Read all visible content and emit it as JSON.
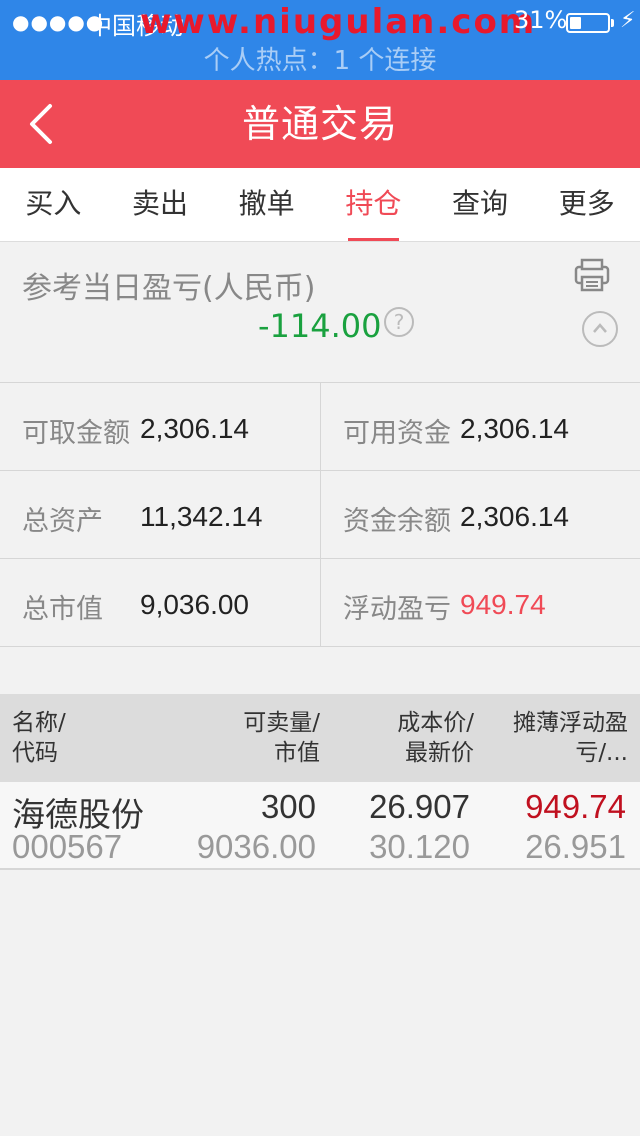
{
  "status_bar": {
    "signal": "●●●●●",
    "carrier": "中国移动",
    "watermark": "www.niugulan.com",
    "battery_percent": "31%",
    "battery_level": 0.31,
    "hotspot": "个人热点：1 个连接"
  },
  "nav": {
    "title": "普通交易"
  },
  "tabs": [
    {
      "label": "买入"
    },
    {
      "label": "卖出"
    },
    {
      "label": "撤单"
    },
    {
      "label": "持仓",
      "active": true
    },
    {
      "label": "查询"
    },
    {
      "label": "更多"
    }
  ],
  "summary": {
    "label": "参考当日盈亏(人民币)",
    "value": "-114.00",
    "help": "?"
  },
  "funds": [
    {
      "label": "可取金额",
      "value": "2,306.14"
    },
    {
      "label": "可用资金",
      "value": "2,306.14"
    },
    {
      "label": "总资产",
      "value": "11,342.14"
    },
    {
      "label": "资金余额",
      "value": "2,306.14"
    },
    {
      "label": "总市值",
      "value": "9,036.00"
    },
    {
      "label": "浮动盈亏",
      "value": "949.74"
    }
  ],
  "holdings": {
    "headers": [
      {
        "line1": "名称/",
        "line2": "代码"
      },
      {
        "line1": "可卖量/",
        "line2": "市值"
      },
      {
        "line1": "成本价/",
        "line2": "最新价"
      },
      {
        "line1": "摊薄浮动盈",
        "line2": "亏/..."
      }
    ],
    "rows": [
      {
        "name": "海德股份",
        "code": "000567",
        "sellable": "300",
        "market_value": "9036.00",
        "cost": "26.907",
        "latest": "30.120",
        "float_pnl": "949.74",
        "diluted": "26.951"
      }
    ]
  },
  "colors": {
    "status_bar": "#2f86e8",
    "nav_bar": "#f04a56",
    "active_tab": "#f04a56",
    "loss": "#1aa13f",
    "profit": "#f04a56"
  }
}
